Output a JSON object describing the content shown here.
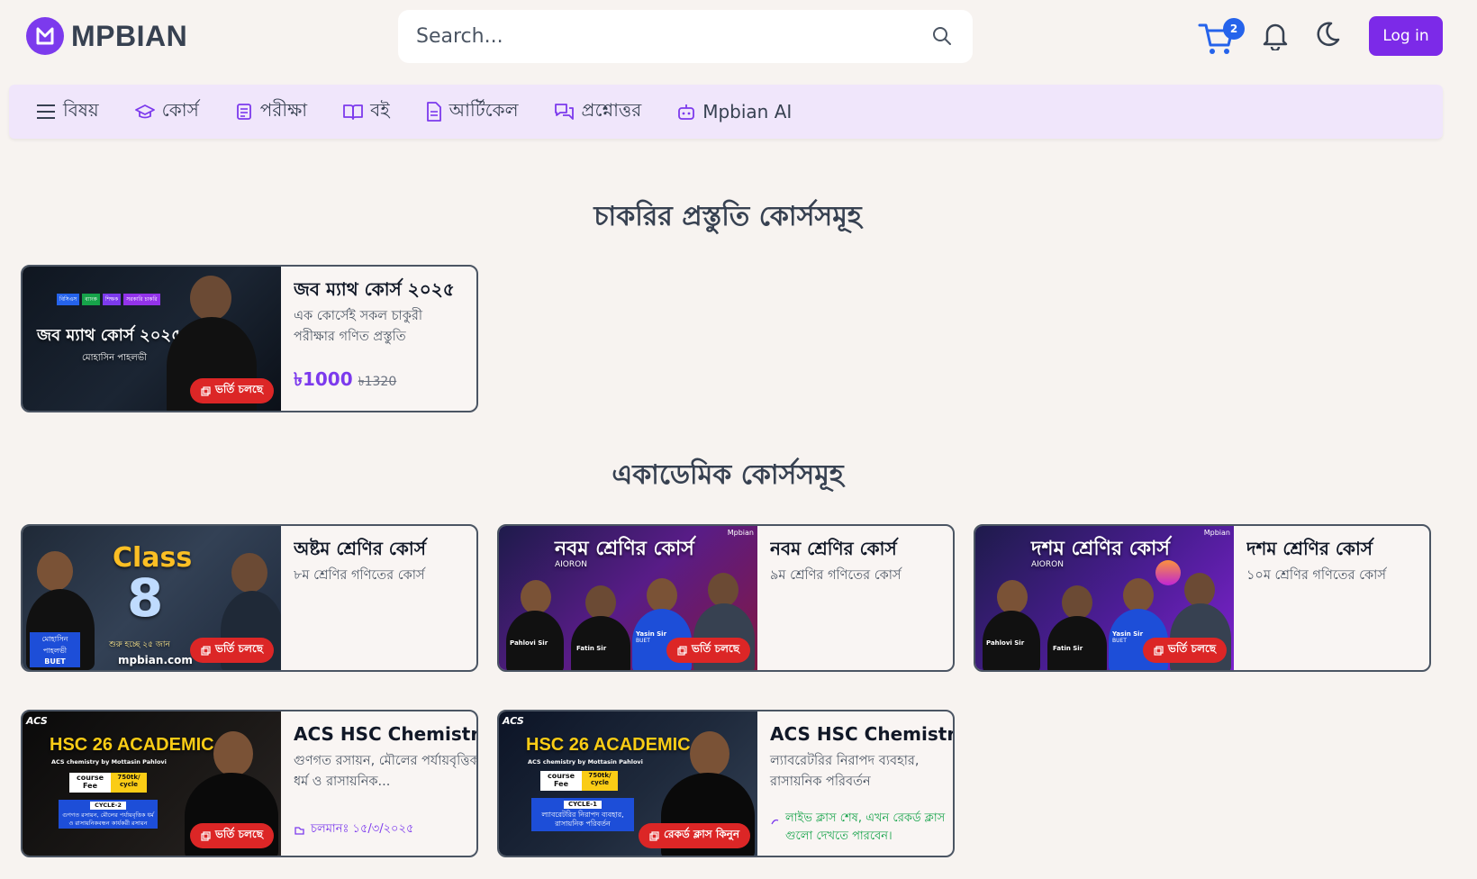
{
  "header": {
    "brand": "MPBIAN",
    "search_placeholder": "Search...",
    "cart_count": "2",
    "login_label": "Log in"
  },
  "nav": [
    {
      "label": "বিষয়",
      "icon": "menu-icon"
    },
    {
      "label": "কোর্স",
      "icon": "graduation-cap-icon"
    },
    {
      "label": "পরীক্ষা",
      "icon": "exam-icon"
    },
    {
      "label": "বই",
      "icon": "book-icon"
    },
    {
      "label": "আর্টিকেল",
      "icon": "document-icon"
    },
    {
      "label": "প্রশ্নোত্তর",
      "icon": "chat-icon"
    },
    {
      "label": "Mpbian AI",
      "icon": "bot-icon"
    }
  ],
  "sections": {
    "job_title": "চাকরির প্রস্তুতি কোর্সসমূহ",
    "academic_title": "একাডেমিক কোর্সসমূহ"
  },
  "cards": [
    {
      "title": "জব ম্যাথ কোর্স ২০২৫",
      "desc": "এক কোর্সেই সকল চাকুরী পরীক্ষার গণিত প্রস্তুতি",
      "price": "৳1000",
      "old_price": "৳1320",
      "badge": "ভর্তি চলছে",
      "thumb_title": "জব ম্যাথ কোর্স ২০২৫",
      "thumb_sub": "মোহাসিন পাহলভী",
      "thumb_tags": [
        "বিসিএস",
        "ব্যাংক",
        "শিক্ষক",
        "সরকারি চাকরি"
      ]
    },
    {
      "title": "অষ্টম শ্রেণির কোর্স",
      "desc": "৮ম শ্রেণির গণিতের কোর্স",
      "badge": "ভর্তি চলছে",
      "thumb_title": "Class",
      "thumb_number": "8",
      "thumb_sub": "শুরু হচ্ছে ২৫ জান",
      "thumb_site": "mpbian.com",
      "thumb_name": "মোহাসিন পাহলভী",
      "thumb_school": "BUET"
    },
    {
      "title": "নবম শ্রেণির কোর্স",
      "desc": "৯ম শ্রেণির গণিতের কোর্স",
      "badge": "ভর্তি চলছে",
      "thumb_title": "নবম শ্রেণির কোর্স",
      "thumb_brand": "Mpbian",
      "thumb_logo": "AIORON",
      "thumb_names": [
        "Pahlovi Sir",
        "Fatin Sir",
        "Yasin Sir"
      ],
      "thumb_school": "BUET"
    },
    {
      "title": "দশম শ্রেণির কোর্স",
      "desc": "১০ম শ্রেণির গণিতের কোর্স",
      "badge": "ভর্তি চলছে",
      "thumb_title": "দশম শ্রেণির কোর্স",
      "thumb_brand": "Mpbian",
      "thumb_logo": "AIORON",
      "thumb_names": [
        "Pahlovi Sir",
        "Fatin Sir",
        "Yasin Sir"
      ],
      "thumb_school": "BUET"
    },
    {
      "title": "ACS HSC Chemistry",
      "desc": "গুণগত রসায়ন, মৌলের পর্যায়বৃত্তিক ধর্ম ও রাসায়নিক...",
      "meta": "চলমানঃ ১৫/৩/২০২৫",
      "badge": "ভর্তি চলছে",
      "thumb_logo": "ACS",
      "thumb_title": "HSC 26 ACADEMIC",
      "thumb_sub": "ACS chemistry by Mottasin Pahlovi",
      "thumb_fee_label": "course Fee",
      "thumb_fee_value": "750tk/ cycle",
      "thumb_cycle": "CYCLE-2",
      "thumb_cycle_text": "গুণগত রসায়ন, মৌলের পর্যায়বৃত্তিক ধর্ম ও রাসায়নিকবন্ধন কার্যকরী রসায়ন"
    },
    {
      "title": "ACS HSC Chemistry",
      "desc": "ল্যাবরেটরির নিরাপদ ব্যবহার, রাসায়নিক পরিবর্তন",
      "meta": "লাইভ ক্লাস শেষ, এখন রেকর্ড ক্লাস গুলো দেখতে পারবেন।",
      "badge": "রেকর্ড ক্লাস কিনুন",
      "thumb_logo": "ACS",
      "thumb_title": "HSC 26 ACADEMIC",
      "thumb_sub": "ACS chemistry by Mottasin Pahlovi",
      "thumb_fee_label": "course Fee",
      "thumb_fee_value": "750tk/ cycle",
      "thumb_cycle": "CYCLE-1",
      "thumb_cycle_text": "ল্যাবরেটরির নিরাপদ ব্যবহার, রাসায়নিক পরিবর্তন"
    }
  ],
  "colors": {
    "accent": "#7c3aed",
    "badge_red": "#dc2626",
    "cart_blue": "#2563eb",
    "nav_bg": "#f0e6fb",
    "page_bg": "#f7f3f0"
  }
}
